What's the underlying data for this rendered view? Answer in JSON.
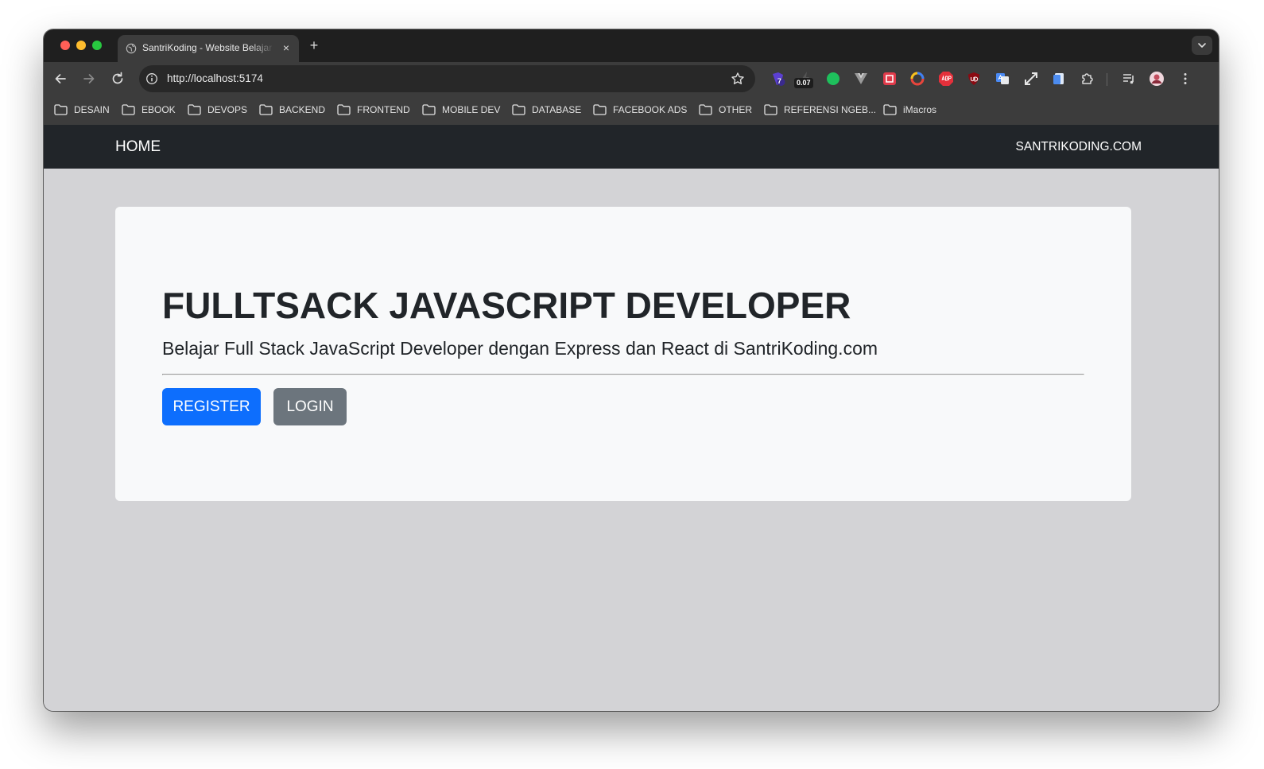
{
  "browser": {
    "tab_title": "SantriKoding - Website Belajar",
    "tab_close": "×",
    "new_tab": "+",
    "url": "http://localhost:5174",
    "extension_badge": "0.07",
    "extension_count": "7",
    "bookmarks": [
      "DESAIN",
      "EBOOK",
      "DEVOPS",
      "BACKEND",
      "FRONTEND",
      "MOBILE DEV",
      "DATABASE",
      "FACEBOOK ADS",
      "OTHER",
      "REFERENSI NGEB...",
      "iMacros"
    ]
  },
  "navbar": {
    "brand": "HOME",
    "site_link": "SANTRIKODING.COM"
  },
  "hero": {
    "title": "FULLTSACK JAVASCRIPT DEVELOPER",
    "subtitle": "Belajar Full Stack JavaScript Developer dengan Express dan React di SantriKoding.com",
    "register_label": "REGISTER",
    "login_label": "LOGIN"
  },
  "colors": {
    "navbar_bg": "#212529",
    "primary": "#0d6efd",
    "secondary": "#6c757d",
    "page_bg": "#d3d3d6",
    "card_bg": "#f8f9fa"
  }
}
